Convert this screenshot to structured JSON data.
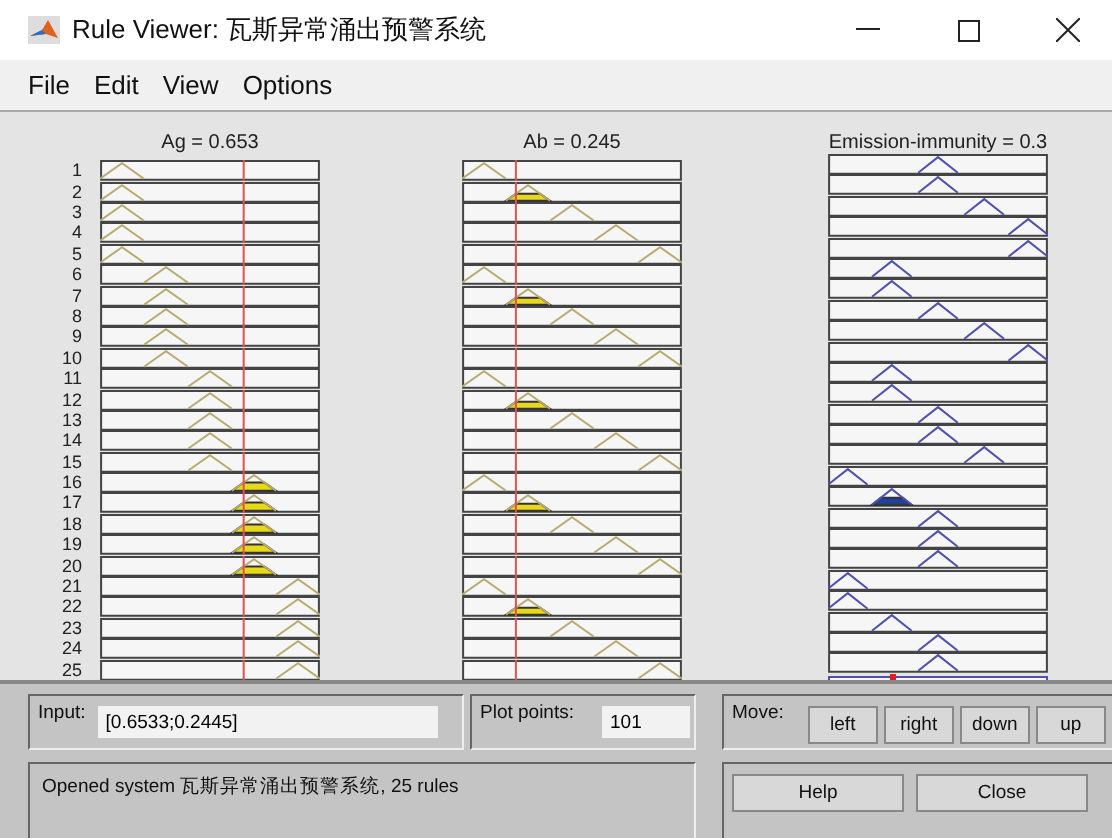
{
  "window": {
    "title": "Rule Viewer: 瓦斯异常涌出预警系统"
  },
  "menu": [
    "File",
    "Edit",
    "View",
    "Options"
  ],
  "columns": [
    {
      "title": "Ag = 0.653",
      "level": 0.653,
      "kind": "input"
    },
    {
      "title": "Ab = 0.245",
      "level": 0.245,
      "kind": "input"
    },
    {
      "title": "Emission-immunity = 0.3",
      "kind": "output"
    }
  ],
  "rules": [
    {
      "number": "1",
      "ag_fired": false,
      "ab_fired": false,
      "out_fired": false
    },
    {
      "number": "2",
      "ag_fired": false,
      "ab_fired": true,
      "out_fired": false
    },
    {
      "number": "3",
      "ag_fired": false,
      "ab_fired": false,
      "out_fired": false
    },
    {
      "number": "4",
      "ag_fired": false,
      "ab_fired": false,
      "out_fired": false
    },
    {
      "number": "5",
      "ag_fired": false,
      "ab_fired": false,
      "out_fired": false
    },
    {
      "number": "6",
      "ag_fired": false,
      "ab_fired": false,
      "out_fired": false
    },
    {
      "number": "7",
      "ag_fired": false,
      "ab_fired": true,
      "out_fired": false
    },
    {
      "number": "8",
      "ag_fired": false,
      "ab_fired": false,
      "out_fired": false
    },
    {
      "number": "9",
      "ag_fired": false,
      "ab_fired": false,
      "out_fired": false
    },
    {
      "number": "10",
      "ag_fired": false,
      "ab_fired": false,
      "out_fired": false
    },
    {
      "number": "11",
      "ag_fired": false,
      "ab_fired": false,
      "out_fired": false
    },
    {
      "number": "12",
      "ag_fired": false,
      "ab_fired": true,
      "out_fired": false
    },
    {
      "number": "13",
      "ag_fired": false,
      "ab_fired": false,
      "out_fired": false
    },
    {
      "number": "14",
      "ag_fired": false,
      "ab_fired": false,
      "out_fired": false
    },
    {
      "number": "15",
      "ag_fired": false,
      "ab_fired": false,
      "out_fired": false
    },
    {
      "number": "16",
      "ag_fired": true,
      "ab_fired": false,
      "out_fired": false
    },
    {
      "number": "17",
      "ag_fired": true,
      "ab_fired": true,
      "out_fired": true
    },
    {
      "number": "18",
      "ag_fired": true,
      "ab_fired": false,
      "out_fired": false
    },
    {
      "number": "19",
      "ag_fired": true,
      "ab_fired": false,
      "out_fired": false
    },
    {
      "number": "20",
      "ag_fired": true,
      "ab_fired": false,
      "out_fired": false
    },
    {
      "number": "21",
      "ag_fired": false,
      "ab_fired": false,
      "out_fired": false
    },
    {
      "number": "22",
      "ag_fired": false,
      "ab_fired": true,
      "out_fired": false
    },
    {
      "number": "23",
      "ag_fired": false,
      "ab_fired": false,
      "out_fired": false
    },
    {
      "number": "24",
      "ag_fired": false,
      "ab_fired": false,
      "out_fired": false
    },
    {
      "number": "25",
      "ag_fired": false,
      "ab_fired": false,
      "out_fired": false
    }
  ],
  "input": {
    "label": "Input:",
    "value": "[0.6533;0.2445]"
  },
  "plot_points": {
    "label": "Plot points:",
    "value": "101"
  },
  "move": {
    "label": "Move:",
    "buttons": [
      "left",
      "right",
      "down",
      "up"
    ]
  },
  "status": "Opened system 瓦斯异常涌出预警系统, 25 rules",
  "buttons": [
    "Help",
    "Close"
  ]
}
